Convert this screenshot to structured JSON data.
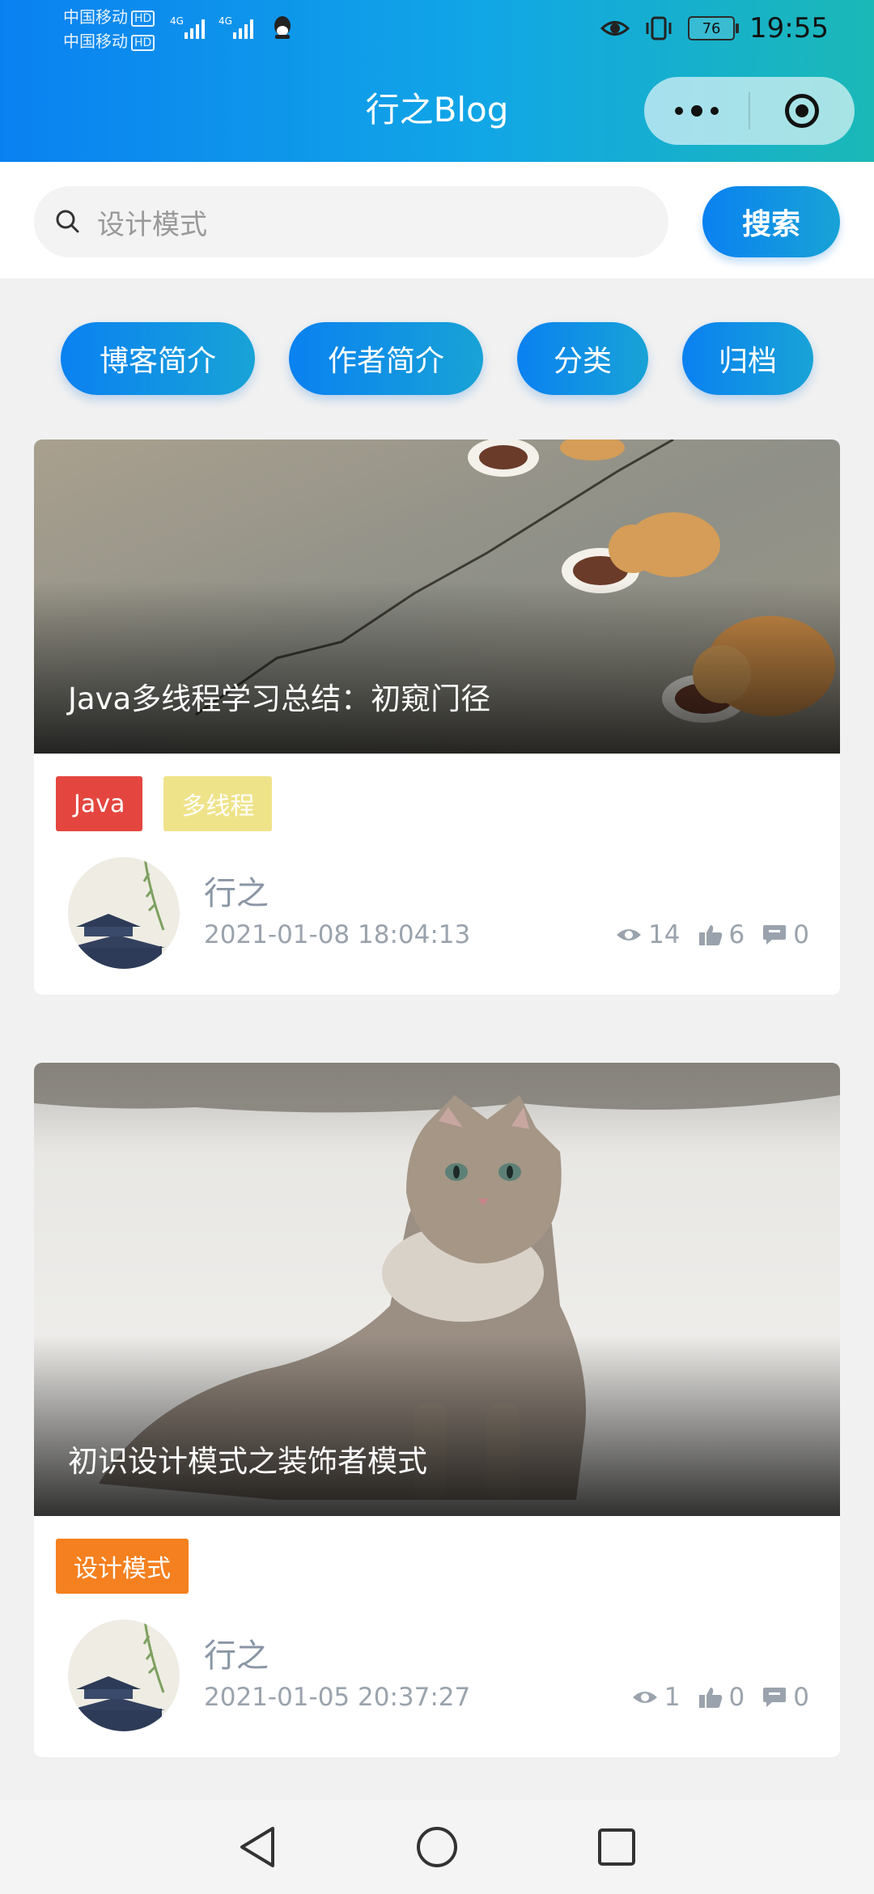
{
  "status_bar": {
    "carrier_1": "中国移动",
    "carrier_2": "中国移动",
    "hd": "HD",
    "net_1": "4G",
    "net_2": "4G",
    "battery": "76",
    "time": "19:55"
  },
  "app": {
    "title": "行之Blog"
  },
  "search": {
    "value": "设计模式",
    "button_label": "搜索"
  },
  "nav": [
    "博客简介",
    "作者简介",
    "分类",
    "归档"
  ],
  "posts": [
    {
      "title": "Java多线程学习总结：初窥门径",
      "tags": [
        {
          "label": "Java",
          "color": "#e4463f"
        },
        {
          "label": "多线程",
          "color": "#efe38a"
        }
      ],
      "author": "行之",
      "date": "2021-01-08 18:04:13",
      "views": "14",
      "likes": "6",
      "comments": "0"
    },
    {
      "title": "初识设计模式之装饰者模式",
      "tags": [
        {
          "label": "设计模式",
          "color": "#f5801f"
        }
      ],
      "author": "行之",
      "date": "2021-01-05 20:37:27",
      "views": "1",
      "likes": "0",
      "comments": "0"
    }
  ],
  "colors": {
    "primary": "#0a81f1",
    "secondary": "#18a3d6",
    "muted": "#9aa3ad",
    "background": "#f1f1f1"
  },
  "icons": {
    "search": "search-icon",
    "views": "eye-icon",
    "likes": "thumbs-up-icon",
    "comments": "comment-icon",
    "capsule_more": "more-dots-icon",
    "capsule_close": "target-icon",
    "nav_back": "back-triangle-icon",
    "nav_home": "home-circle-icon",
    "nav_recent": "recent-square-icon"
  }
}
